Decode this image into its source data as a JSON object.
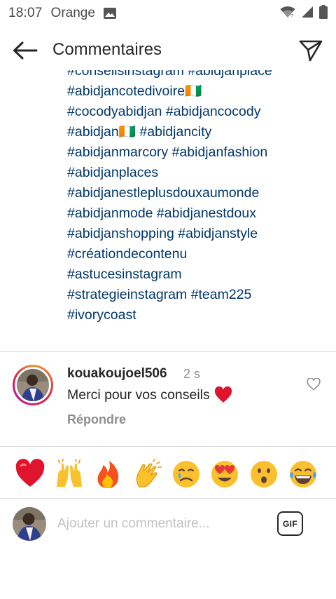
{
  "status_bar": {
    "time": "18:07",
    "carrier": "Orange",
    "icons": [
      "image-icon",
      "wifi-icon",
      "signal-icon",
      "battery-icon"
    ]
  },
  "header": {
    "title": "Commentaires",
    "back_icon": "arrow-left-icon",
    "send_icon": "send-icon"
  },
  "caption": {
    "lines": [
      "#conseilsinstagram #abidjanplace",
      "#abidjancotedivoire🇨🇮",
      "#cocodyabidjan #abidjancocody",
      "#abidjan🇨🇮 #abidjancity",
      "#abidjanmarcory #abidjanfashion",
      "#abidjanplaces",
      "#abidjanestleplusdouxaumonde",
      "#abidjanmode #abidjanestdoux",
      "#abidjanshopping #abidjanstyle",
      "#créationdecontenu",
      "#astucesinstagram",
      "#strategieinstagram #team225",
      "#ivorycoast"
    ]
  },
  "comment": {
    "username": "kouakoujoel506",
    "time": "2 s",
    "text": "Merci pour vos conseils",
    "reply_label": "Répondre"
  },
  "emoji_bar": {
    "items": [
      "red-heart",
      "raising-hands",
      "fire",
      "clapping-hands",
      "crying-face",
      "heart-eyes-face",
      "surprised-face",
      "tears-of-joy-face"
    ]
  },
  "composer": {
    "placeholder": "Ajouter un commentaire...",
    "value": "",
    "gif_label": "GIF"
  },
  "colors": {
    "hashtag": "#00376b",
    "secondary_text": "#8e8e8e",
    "divider": "#dbdbdb",
    "heart_red": "#e0142c"
  }
}
